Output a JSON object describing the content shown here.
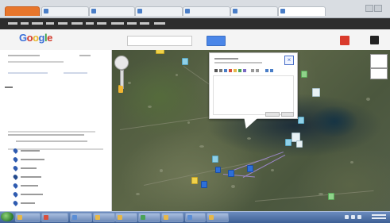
{
  "header": {
    "logo_text": "Google"
  },
  "taskbar": {
    "items": [
      {
        "icon": "folder-icon",
        "color": "#e6b84a"
      },
      {
        "icon": "chrome-icon",
        "color": "#d94f3d"
      },
      {
        "icon": "document-icon",
        "color": "#5b8ed6"
      },
      {
        "icon": "document-icon",
        "color": "#e6b84a"
      },
      {
        "icon": "document-icon",
        "color": "#e6b84a"
      },
      {
        "icon": "spreadsheet-icon",
        "color": "#4aa356"
      },
      {
        "icon": "document-icon",
        "color": "#e6b84a"
      },
      {
        "icon": "document-icon",
        "color": "#5b8ed6"
      },
      {
        "icon": "document-icon",
        "color": "#e6b84a"
      }
    ]
  },
  "colors": {
    "accent_blue": "#4a86e8",
    "share_red": "#d93a2b",
    "taskbar_top": "#6b8cbf",
    "taskbar_bottom": "#3d5f94",
    "active_tab_orange": "#e7762c"
  }
}
